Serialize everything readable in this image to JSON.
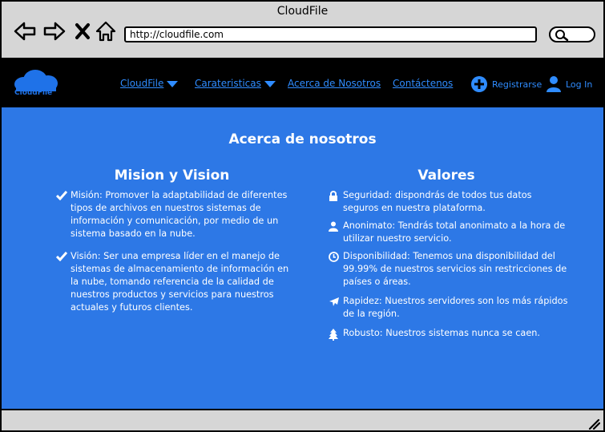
{
  "window": {
    "title": "CloudFile"
  },
  "address_bar": {
    "url": "http://cloudfile.com"
  },
  "header": {
    "logo_text": "CloudFile",
    "menu": [
      {
        "label": "CloudFile",
        "has_dropdown": true
      },
      {
        "label": "Carateristicas",
        "has_dropdown": true
      },
      {
        "label": "Acerca de Nosotros",
        "has_dropdown": false
      },
      {
        "label": "Contáctenos",
        "has_dropdown": false
      }
    ],
    "register_label": "Registrarse",
    "login_label": "Log In"
  },
  "main": {
    "title": "Acerca de nosotros",
    "mission_vision": {
      "title": "Mision y Vision",
      "items": [
        {
          "icon": "check-icon",
          "text": "Misión: Promover la adaptabilidad de diferentes tipos de archivos en nuestros sistemas de información y comunicación, por medio de un sistema basado en la nube."
        },
        {
          "icon": "check-icon",
          "text": "Visión: Ser una empresa líder en el manejo de sistemas de almacenamiento de información en la nube, tomando referencia de la calidad de nuestros productos y servicios para nuestros actuales y futuros clientes."
        }
      ]
    },
    "values": {
      "title": "Valores",
      "items": [
        {
          "icon": "lock-icon",
          "text": "Seguridad: dispondrás de todos tus datos seguros en nuestra plataforma."
        },
        {
          "icon": "user-icon",
          "text": "Anonimato: Tendrás total anonimato a la hora de utilizar nuestro servicio."
        },
        {
          "icon": "clock-icon",
          "text": "Disponibilidad: Tenemos una disponibilidad del 99.99% de nuestros servicios sin restricciones de países o áreas."
        },
        {
          "icon": "plane-icon",
          "text": "Rapidez: Nuestros servidores son los más rápidos de la región."
        },
        {
          "icon": "tree-icon",
          "text": "Robusto: Nuestros sistemas nunca se caen."
        }
      ]
    }
  },
  "colors": {
    "chrome": "#d6d6d6",
    "header_bg": "#000000",
    "accent": "#2f8cff",
    "content_bg": "#2d78e6",
    "text": "#ffffff"
  }
}
